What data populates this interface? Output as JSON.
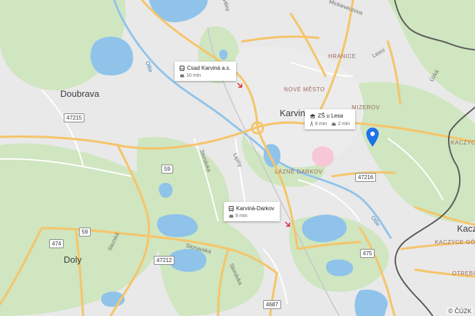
{
  "map": {
    "towns": {
      "karvina": "Karvin",
      "doubrava": "Doubrava",
      "doly": "Doly",
      "kacz": "Kacz"
    },
    "districts": {
      "hranice": "HRANICE",
      "nove_mesto": "NOVÉ MĚSTO",
      "mizerov": "MIZEROV",
      "lazne_darkov": "LÁZNĚ DARKOV",
      "kaczyce_gorne": "KACZYCE GÓRN",
      "kaczyce": "KACZYCE",
      "otrebo": "OTRĘBO"
    },
    "streets": {
      "mickiewiczova": "Mickiewiczova",
      "hliny": "Hliny",
      "lesni": "Lesní",
      "uzka": "Úzká",
      "stonavka1": "Stonávka",
      "lipiny": "Lipiny",
      "slezska": "Slezská",
      "stonavska": "Stonavská",
      "stonavka2": "Stonávka"
    },
    "water": {
      "olse_west": "Olše",
      "olse_east": "Olše"
    },
    "shields": {
      "r47215": "47215",
      "r59a": "59",
      "r59b": "59",
      "r474": "474",
      "r47212": "47212",
      "r47216": "47216",
      "r475": "475",
      "r4687": "4687"
    },
    "copyright": "© ČÚZK"
  },
  "cards": {
    "csad": {
      "icon": "bus-icon",
      "title": "Csad Karviná a.s.",
      "car_time": "10 min"
    },
    "zs": {
      "icon": "school-icon",
      "title": "ZŠ u Lesa",
      "walk_time": "8 min",
      "car_time": "2 min"
    },
    "darkov": {
      "icon": "bus-icon",
      "title": "Karviná-Darkov",
      "car_time": "9 min"
    }
  },
  "colors": {
    "road_major": "#f5c56b",
    "road_minor": "#ffffff",
    "water": "#8fc3ea",
    "green": "#cfe6c0",
    "border": "#5a5a5a",
    "pin": "#1e73e8"
  }
}
